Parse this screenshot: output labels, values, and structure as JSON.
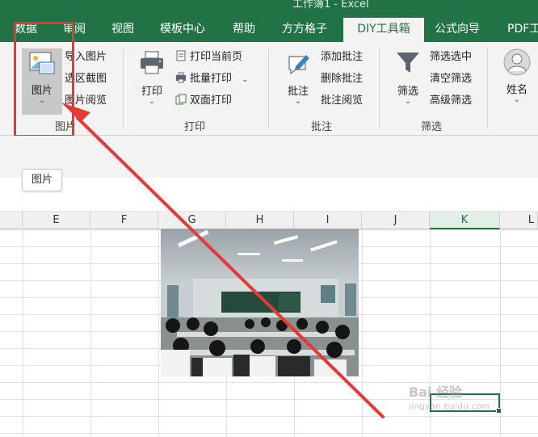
{
  "window": {
    "title": "工作簿1 - Excel"
  },
  "tabs": [
    {
      "label": "数据",
      "active": false
    },
    {
      "label": "审阅",
      "active": false
    },
    {
      "label": "视图",
      "active": false
    },
    {
      "label": "模板中心",
      "active": false
    },
    {
      "label": "帮助",
      "active": false
    },
    {
      "label": "方方格子",
      "active": false
    },
    {
      "label": "DIY工具箱",
      "active": true
    },
    {
      "label": "公式向导",
      "active": false
    },
    {
      "label": "PDF工",
      "active": false
    }
  ],
  "ribbon": {
    "picture_group": {
      "big_label": "图片",
      "items": [
        "导入图片",
        "选区截图",
        "图片阅览"
      ],
      "group_label": "图片"
    },
    "print_group": {
      "big_label": "打印",
      "items": [
        "打印当前页",
        "批量打印",
        "双面打印"
      ],
      "group_label": "打印"
    },
    "comment_group": {
      "big_label": "批注",
      "items": [
        "添加批注",
        "删除批注",
        "批注阅览"
      ],
      "group_label": "批注"
    },
    "filter_group": {
      "big_label": "筛选",
      "items": [
        "筛选选中",
        "清空筛选",
        "高级筛选"
      ],
      "group_label": "筛选"
    },
    "name_group": {
      "big_label": "姓名"
    },
    "chevron": "⌄"
  },
  "tooltip": {
    "text": "图片"
  },
  "columns": [
    "E",
    "F",
    "G",
    "H",
    "I",
    "J",
    "K",
    "L"
  ],
  "selected_column": "K",
  "watermark": {
    "main": "Bai 经验",
    "sub": "jingyan.baidu.com"
  },
  "colors": {
    "accent": "#217346",
    "highlight_red": "#e53935"
  }
}
